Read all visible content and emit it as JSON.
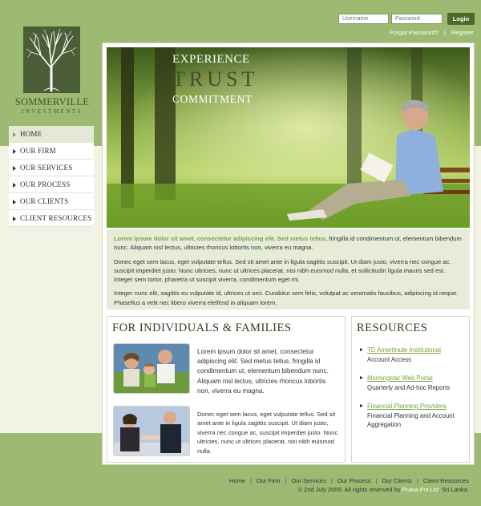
{
  "login": {
    "username_placeholder": "Username",
    "password_placeholder": "Password",
    "button": "Login",
    "forgot": "Forgot Password?",
    "separator": "|",
    "register": "Register"
  },
  "logo": {
    "name": "SOMMERVILLE",
    "sub": "INVESTMENTS",
    "icon": "tree-icon"
  },
  "nav": {
    "items": [
      {
        "label": "HOME"
      },
      {
        "label": "OUR FIRM"
      },
      {
        "label": "OUR SERVICES"
      },
      {
        "label": "OUR PROCESS"
      },
      {
        "label": "OUR CLIENTS"
      },
      {
        "label": "CLIENT RESOURCES"
      }
    ]
  },
  "hero": {
    "line1": "EXPERIENCE",
    "line2": "TRUST",
    "line3": "COMMITMENT"
  },
  "intro": {
    "lead": "Lorem ipsum dolor sit amet, consectetur adipiscing elit. Sed metus tellus,",
    "p1_rest": " fringilla id condimentum ut, elementum bibendum nunc. Aliquam nisl lectus, ultricies rhoncus lobortis non, viverra eu magna.",
    "p2": "Donec eget sem lacus, eget vulputate tellus. Sed sit amet ante in ligula sagittis suscipit. Ut diam justo, viverra nec congue ac, suscipit imperdiet justo. Nunc ultricies, nunc ut ultrices placerat, nisi nibh euismod nulla, et sollicitudin ligula mauris sed est. Integer sem tortor, pharetra ut suscipit viverra, condimentum eget mi.",
    "p3": "Integer nunc elit, sagittis eu vulputate id, ultrices ut orci. Curabitur sem felis, volutpat ac venenatis faucibus, adipiscing id neque. Phasellus a velit nec libero viverra eleifend in aliquam lorem."
  },
  "individuals": {
    "title": "FOR INDIVIDUALS & FAMILIES",
    "text1": "Lorem ipsum dolor sit amet, consectetur adipiscing elit. Sed metus tellus, fringilla id condimentum ut, elementum bibendum nunc. Aliquam nisl lectus, ultricies rhoncus lobortis non, viverra eu magna.",
    "text2": "Donec eget sem lacus, eget vulputate tellus. Sed sit amet ante in ligula sagittis suscipit. Ut diam justo, viverra nec congue ac, suscipit imperdiet justo. Nunc ultricies, nunc ut ultrices placerat, nisi nibh euismod nulla."
  },
  "resources": {
    "title": "RESOURCES",
    "items": [
      {
        "link": "TD Ameritrade Institutional",
        "desc": "Account Access"
      },
      {
        "link": "Morningstar Web Portal",
        "desc": "Quarterly and Ad-hoc Reports"
      },
      {
        "link": "Financial Planning Providers",
        "desc": "Financial Planning and Account Aggregation"
      }
    ]
  },
  "footer": {
    "links": [
      "Home",
      "Our Firm",
      "Our Services",
      "Our Process",
      "Our Clients",
      "Client Resources"
    ],
    "separator": "|",
    "copy_pre": "© 2nd July 2009. All rights reserved by",
    "brand": "Prana Pvt Ltd",
    "copy_post": ", Sri Lanka."
  },
  "colors": {
    "accent_green": "#7aa342",
    "background_green": "#9dba72",
    "logo_green": "#4b5e37",
    "login_button": "#4d6a2c"
  }
}
